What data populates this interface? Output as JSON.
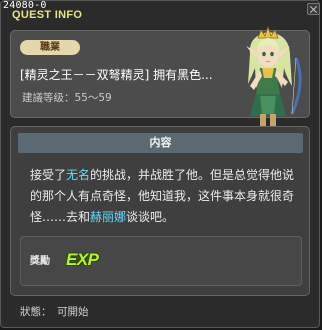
{
  "window": {
    "quest_id": "24080-0",
    "title": "QUEST INFO"
  },
  "header": {
    "job_badge": "職業",
    "quest_name": "[精灵之王－－双弩精灵] 拥有黑色...",
    "recommended_level": "建議等级：55～59",
    "portrait_icon": "elf-queen-portrait"
  },
  "content": {
    "title": "内容",
    "description": {
      "part1": "接受了",
      "highlight1": "无名",
      "part2": "的挑战，并战胜了他。但是总觉得他说的那个人有点奇怪，他知道我，这件事本身就很奇怪……去和",
      "highlight2": "赫丽娜",
      "part3": "谈谈吧。"
    },
    "highlight_color": "#66ddff"
  },
  "reward": {
    "label": "獎勵",
    "exp_text": "EXP",
    "exp_color": "#b7f03a"
  },
  "status": {
    "label": "狀態：",
    "value": "可開始"
  },
  "colors": {
    "title_yellow": "#e9e28b",
    "badge_bg": "#e4d7ad",
    "content_title_bar": "#5b6a72"
  }
}
